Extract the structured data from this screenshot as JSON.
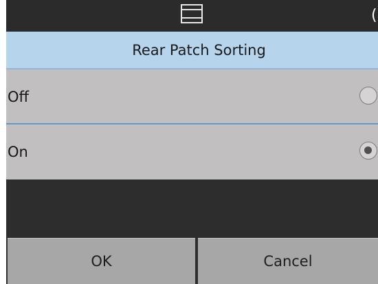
{
  "status_bar": {
    "center_icon": "panel-layout-icon",
    "right_glyph": "(",
    "right_icon": "status-indicator-icon"
  },
  "dialog": {
    "title": "Rear Patch Sorting"
  },
  "options": [
    {
      "label": "Off",
      "selected": false
    },
    {
      "label": "On",
      "selected": true
    }
  ],
  "buttons": {
    "ok_label": "OK",
    "cancel_label": "Cancel"
  },
  "colors": {
    "title_bar": "#b6d4ec",
    "row_background": "#c2bfc1",
    "row_divider": "#5f98c6",
    "button_background": "#a7a7a7",
    "screen_background": "#2d2d2d"
  }
}
